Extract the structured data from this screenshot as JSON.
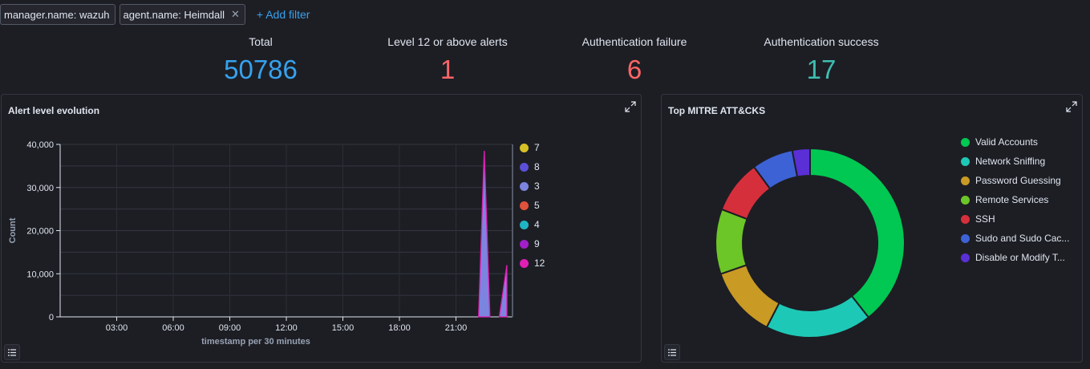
{
  "filters": [
    {
      "label": "manager.name: wazuh",
      "removable": false
    },
    {
      "label": "agent.name: Heimdall",
      "removable": true
    }
  ],
  "add_filter_label": "+ Add filter",
  "metrics": [
    {
      "label": "Total",
      "value": "50786",
      "color": "#36a2ef"
    },
    {
      "label": "Level 12 or above alerts",
      "value": "1",
      "color": "#f66"
    },
    {
      "label": "Authentication failure",
      "value": "6",
      "color": "#f66"
    },
    {
      "label": "Authentication success",
      "value": "17",
      "color": "#3ebeb0"
    }
  ],
  "panels": {
    "alert_level": {
      "title": "Alert level evolution"
    },
    "mitre": {
      "title": "Top MITRE ATT&CKS"
    }
  },
  "chart_data": [
    {
      "type": "area",
      "title": "Alert level evolution",
      "xlabel": "timestamp per 30 minutes",
      "ylabel": "Count",
      "ylim": [
        0,
        40000
      ],
      "yticks": [
        "0",
        "10,000",
        "20,000",
        "30,000",
        "40,000"
      ],
      "xticks": [
        "03:00",
        "06:00",
        "09:00",
        "12:00",
        "15:00",
        "18:00",
        "21:00"
      ],
      "legend": [
        "7",
        "8",
        "3",
        "5",
        "4",
        "9",
        "12"
      ],
      "legend_colors": [
        "#d6bf27",
        "#5a4fd6",
        "#7b85e0",
        "#e0523b",
        "#1fb5c2",
        "#a21ec9",
        "#e01fb5"
      ],
      "series": [
        {
          "name": "3",
          "color": "#7b85e0",
          "points": [
            [
              22.2,
              0
            ],
            [
              22.5,
              38500
            ],
            [
              22.8,
              0
            ],
            [
              23.3,
              0
            ],
            [
              23.7,
              12000
            ]
          ]
        }
      ]
    },
    {
      "type": "pie",
      "title": "Top MITRE ATT&CKS",
      "legend_position": "right",
      "slices": [
        {
          "label": "Valid Accounts",
          "value": 39,
          "color": "#00c853"
        },
        {
          "label": "Network Sniffing",
          "value": 18,
          "color": "#1ec8b6"
        },
        {
          "label": "Password Guessing",
          "value": 12,
          "color": "#c99a24"
        },
        {
          "label": "Remote Services",
          "value": 11,
          "color": "#6cc627"
        },
        {
          "label": "SSH",
          "value": 9,
          "color": "#d62f3c"
        },
        {
          "label": "Sudo and Sudo Cac...",
          "value": 7,
          "color": "#3d62d6"
        },
        {
          "label": "Disable or Modify T...",
          "value": 3,
          "color": "#5a2fd6"
        }
      ]
    }
  ]
}
